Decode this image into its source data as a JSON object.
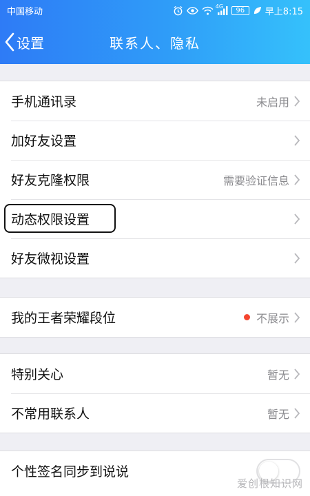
{
  "status_bar": {
    "carrier": "中国移动",
    "network": "4G",
    "battery": "96",
    "time": "早上8:15"
  },
  "nav": {
    "back_label": "设置",
    "title": "联系人、隐私"
  },
  "groups": [
    {
      "rows": [
        {
          "label": "手机通讯录",
          "value": "未启用"
        },
        {
          "label": "加好友设置",
          "value": ""
        },
        {
          "label": "好友克隆权限",
          "value": "需要验证信息"
        },
        {
          "label": "动态权限设置",
          "value": ""
        },
        {
          "label": "好友微视设置",
          "value": ""
        }
      ]
    },
    {
      "rows": [
        {
          "label": "我的王者荣耀段位",
          "value": "不展示"
        }
      ]
    },
    {
      "rows": [
        {
          "label": "特别关心",
          "value": "暂无"
        },
        {
          "label": "不常用联系人",
          "value": "暂无"
        }
      ]
    },
    {
      "rows": [
        {
          "label": "个性签名同步到说说",
          "toggle_on": false
        }
      ]
    }
  ],
  "colors": {
    "header_start": "#2e7bf6",
    "header_end": "#35c1fb",
    "red_dot": "#f5452f",
    "value_text": "#8a8a8e"
  },
  "watermark": "爱创根知识网"
}
